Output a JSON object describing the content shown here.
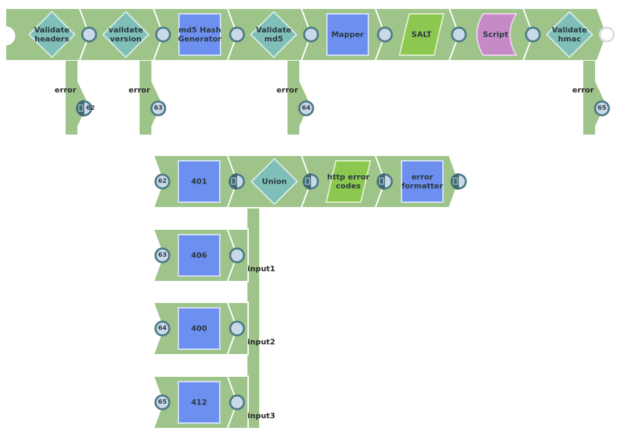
{
  "colors": {
    "track": "#9ec48a",
    "diamond": "#7fbfb8",
    "square": "#6d8ff0",
    "parallelogram": "#8cc850",
    "script": "#c68ac6",
    "port": "#c9d9ea",
    "port_ring": "#4e7c84",
    "doc_port": "#3f6a72"
  },
  "main_pipeline": {
    "nodes": [
      {
        "label": "Validate headers",
        "shape": "diamond"
      },
      {
        "label": "vaildate version",
        "shape": "diamond"
      },
      {
        "label": "md5 Hash Generator",
        "shape": "square"
      },
      {
        "label": "Validate md5",
        "shape": "diamond"
      },
      {
        "label": "Mapper",
        "shape": "square"
      },
      {
        "label": "SALT",
        "shape": "parallelogram"
      },
      {
        "label": "Script",
        "shape": "script"
      },
      {
        "label": "Validate hmac",
        "shape": "diamond"
      }
    ],
    "error_branches": [
      {
        "node_index": 0,
        "label": "error",
        "target": "62",
        "doc_port": true
      },
      {
        "node_index": 1,
        "label": "error",
        "target": "63",
        "doc_port": false
      },
      {
        "node_index": 3,
        "label": "error",
        "target": "64",
        "doc_port": false
      },
      {
        "node_index": 7,
        "label": "error",
        "target": "65",
        "doc_port": false
      }
    ]
  },
  "error_pipeline": {
    "main_row": {
      "source": "62",
      "nodes": [
        {
          "label": "401",
          "shape": "square"
        },
        {
          "label": "Union",
          "shape": "diamond"
        },
        {
          "label": "http error codes",
          "shape": "parallelogram"
        },
        {
          "label": "error formatter",
          "shape": "square"
        }
      ]
    },
    "input_rows": [
      {
        "source": "63",
        "label": "406",
        "input": "input1"
      },
      {
        "source": "64",
        "label": "400",
        "input": "input2"
      },
      {
        "source": "65",
        "label": "412",
        "input": "input3"
      }
    ]
  }
}
